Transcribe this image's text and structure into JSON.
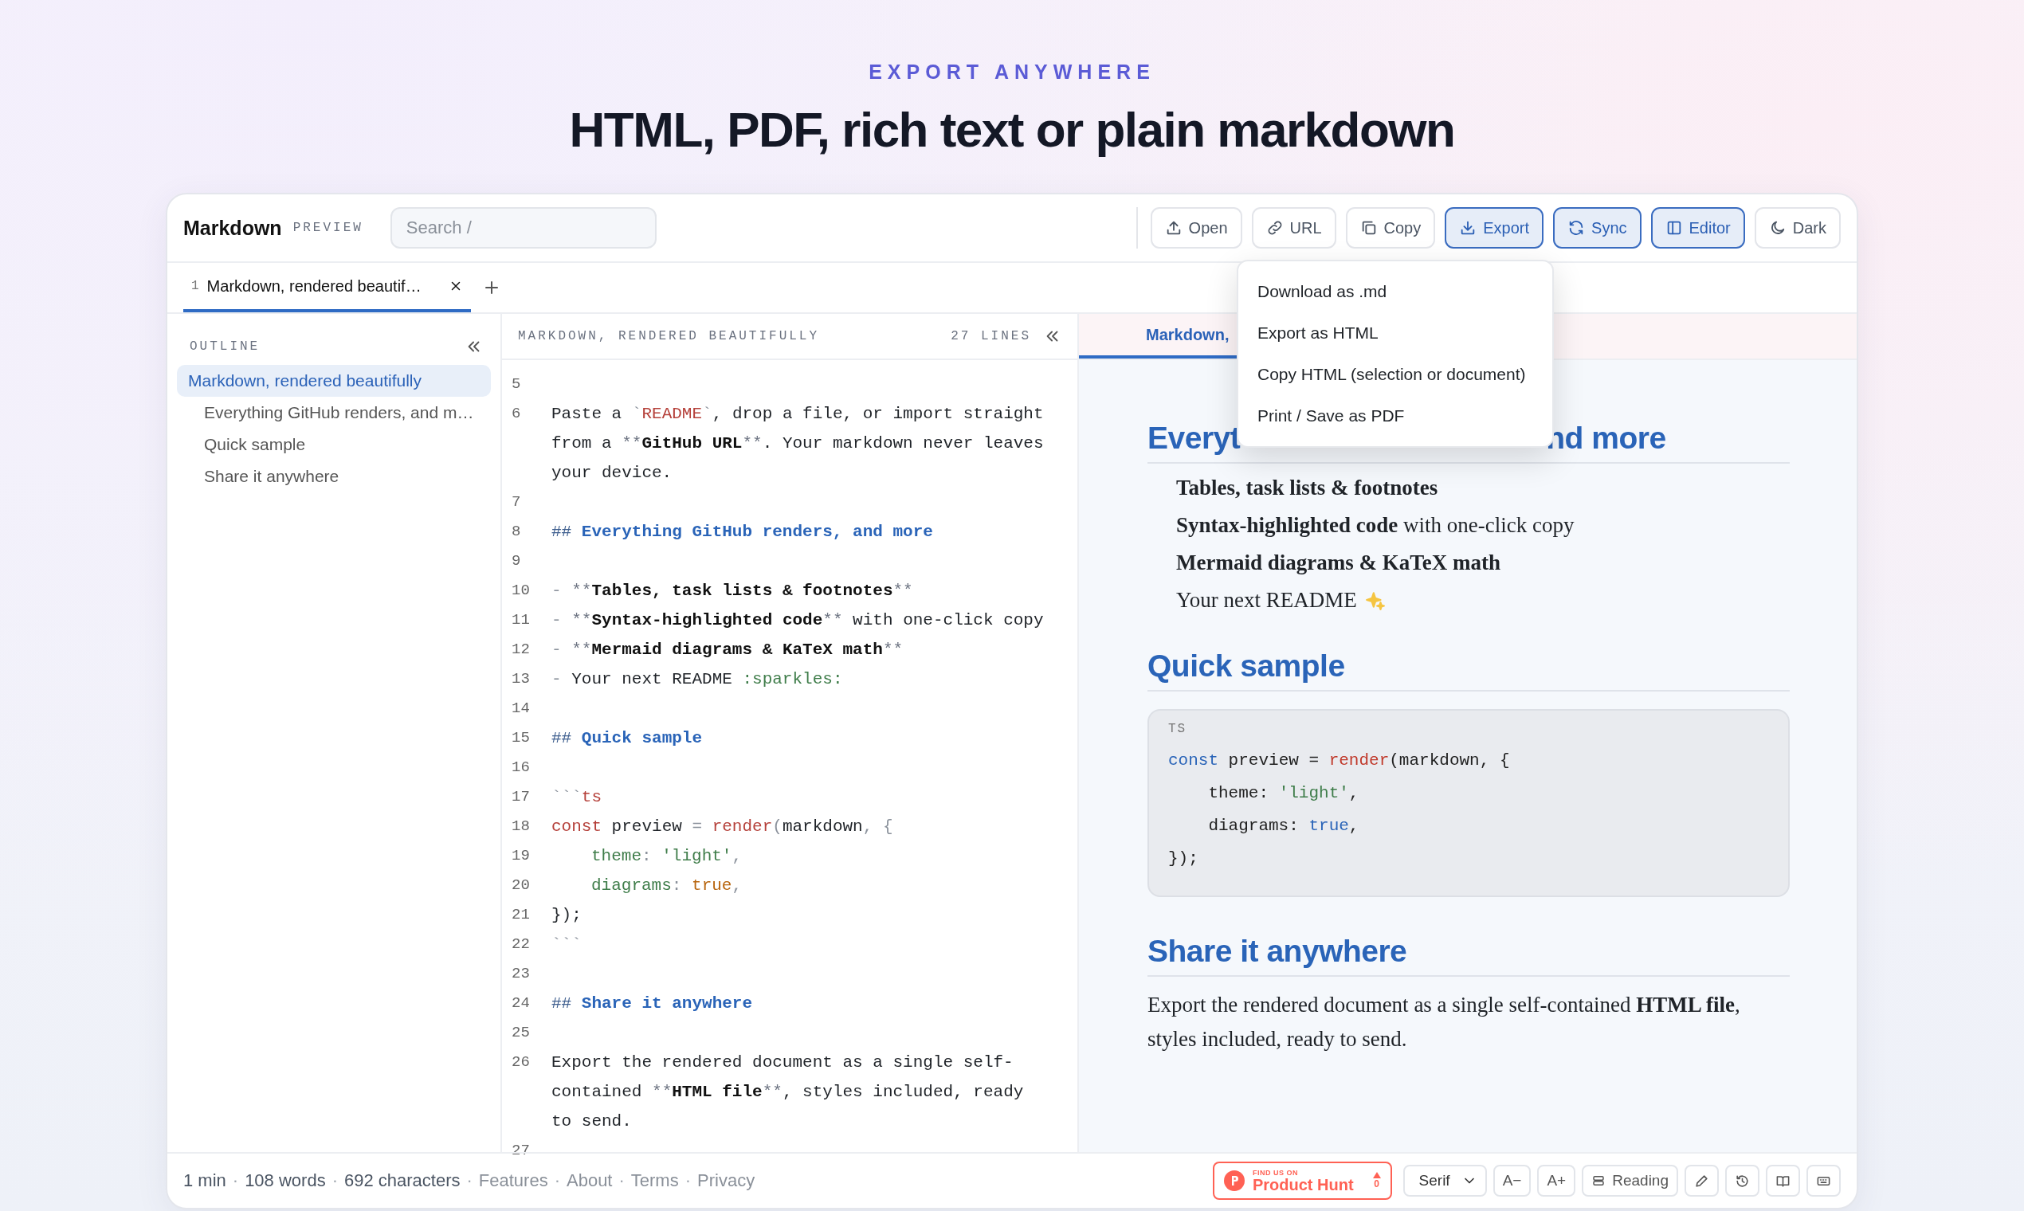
{
  "hero": {
    "eyebrow": "EXPORT ANYWHERE",
    "title": "HTML, PDF, rich text or plain markdown"
  },
  "app": {
    "brand": "Markdown",
    "brand_tag": "PREVIEW",
    "search": {
      "placeholder": "Search /"
    }
  },
  "toolbar": [
    {
      "label": "Open",
      "active": false
    },
    {
      "label": "URL",
      "active": false
    },
    {
      "label": "Copy",
      "active": false
    },
    {
      "label": "Export",
      "active": true
    },
    {
      "label": "Sync",
      "active": true
    },
    {
      "label": "Editor",
      "active": true
    },
    {
      "label": "Dark",
      "active": false
    }
  ],
  "export_menu": {
    "items": [
      "Download as .md",
      "Export as HTML",
      "Copy HTML (selection or document)",
      "Print / Save as PDF"
    ]
  },
  "tabs": [
    {
      "number": "1",
      "label": "Markdown, rendered beautif…",
      "selected": true
    }
  ],
  "outline": {
    "title": "OUTLINE",
    "items": [
      {
        "label": "Markdown, rendered beautifully",
        "selected": true,
        "children": [
          {
            "label": "Everything GitHub renders, and m…",
            "selected": false
          },
          {
            "label": "Quick sample",
            "selected": false
          },
          {
            "label": "Share it anywhere",
            "selected": false
          }
        ]
      }
    ]
  },
  "editor": {
    "title": "MARKDOWN, RENDERED BEAUTIFULLY",
    "line_count": "27 LINES",
    "lines": [
      {
        "number": "5"
      },
      {
        "number": "6",
        "segments": [
          {
            "kind": "text",
            "text": "Paste a "
          },
          {
            "kind": "punct",
            "text": "`"
          },
          {
            "kind": "code",
            "text": "README"
          },
          {
            "kind": "punct",
            "text": "`"
          },
          {
            "kind": "text",
            "text": ", drop a file, or import straight from a "
          },
          {
            "kind": "marker",
            "text": "**"
          },
          {
            "kind": "bold",
            "text": "GitHub URL"
          },
          {
            "kind": "marker",
            "text": "**"
          },
          {
            "kind": "text",
            "text": ". Your markdown never leaves your device."
          }
        ]
      },
      {
        "number": "7"
      },
      {
        "number": "8",
        "segments": [
          {
            "kind": "hmark",
            "text": "## "
          },
          {
            "kind": "heading",
            "text": "Everything GitHub renders, and more"
          }
        ]
      },
      {
        "number": "9"
      },
      {
        "number": "10",
        "segments": [
          {
            "kind": "punct",
            "text": "- "
          },
          {
            "kind": "marker",
            "text": "**"
          },
          {
            "kind": "bold",
            "text": "Tables, task lists & footnotes"
          },
          {
            "kind": "marker",
            "text": "**"
          }
        ]
      },
      {
        "number": "11",
        "segments": [
          {
            "kind": "punct",
            "text": "- "
          },
          {
            "kind": "marker",
            "text": "**"
          },
          {
            "kind": "bold",
            "text": "Syntax-highlighted code"
          },
          {
            "kind": "marker",
            "text": "**"
          },
          {
            "kind": "text",
            "text": " with one-click copy"
          }
        ]
      },
      {
        "number": "12",
        "segments": [
          {
            "kind": "punct",
            "text": "- "
          },
          {
            "kind": "marker",
            "text": "**"
          },
          {
            "kind": "bold",
            "text": "Mermaid diagrams & KaTeX math"
          },
          {
            "kind": "marker",
            "text": "**"
          }
        ]
      },
      {
        "number": "13",
        "segments": [
          {
            "kind": "punct",
            "text": "- "
          },
          {
            "kind": "text",
            "text": "Your next README"
          },
          {
            "kind": "prop",
            "text": " :sparkles:"
          }
        ]
      },
      {
        "number": "14"
      },
      {
        "number": "15",
        "segments": [
          {
            "kind": "hmark",
            "text": "## "
          },
          {
            "kind": "heading",
            "text": "Quick sample"
          }
        ]
      },
      {
        "number": "16"
      },
      {
        "number": "17",
        "segments": [
          {
            "kind": "punct",
            "text": "```"
          },
          {
            "kind": "code",
            "text": "ts"
          }
        ]
      },
      {
        "number": "18",
        "segments": [
          {
            "kind": "keyword",
            "text": "const"
          },
          {
            "kind": "text",
            "text": " preview"
          },
          {
            "kind": "punct",
            "text": " = "
          },
          {
            "kind": "func",
            "text": "render"
          },
          {
            "kind": "punct",
            "text": "("
          },
          {
            "kind": "text",
            "text": "markdown"
          },
          {
            "kind": "punct",
            "text": ", {"
          }
        ]
      },
      {
        "number": "19",
        "indented": true,
        "segments": [
          {
            "kind": "prop",
            "text": "theme"
          },
          {
            "kind": "punct",
            "text": ": "
          },
          {
            "kind": "str",
            "text": "'light'"
          },
          {
            "kind": "punct",
            "text": ","
          }
        ]
      },
      {
        "number": "20",
        "indented": true,
        "segments": [
          {
            "kind": "prop",
            "text": "diagrams"
          },
          {
            "kind": "punct",
            "text": ": "
          },
          {
            "kind": "bool",
            "text": "true"
          },
          {
            "kind": "punct",
            "text": ","
          }
        ]
      },
      {
        "number": "21",
        "segments": [
          {
            "kind": "text",
            "text": "});"
          }
        ]
      },
      {
        "number": "22",
        "segments": [
          {
            "kind": "punct",
            "text": "```"
          }
        ]
      },
      {
        "number": "23"
      },
      {
        "number": "24",
        "segments": [
          {
            "kind": "hmark",
            "text": "## "
          },
          {
            "kind": "heading",
            "text": "Share it anywhere"
          }
        ]
      },
      {
        "number": "25"
      },
      {
        "number": "26",
        "segments": [
          {
            "kind": "text",
            "text": "Export the rendered document as a single self-contained "
          },
          {
            "kind": "marker",
            "text": "**"
          },
          {
            "kind": "bold",
            "text": "HTML file"
          },
          {
            "kind": "marker",
            "text": "**"
          },
          {
            "kind": "text",
            "text": ", styles included, ready to send."
          }
        ]
      },
      {
        "number": "27"
      }
    ]
  },
  "preview": {
    "tabs": [
      {
        "label": "Markdown,",
        "selected": true
      }
    ],
    "blocks": [
      {
        "kind": "heading",
        "parts": [
          "Everyt",
          "nd more"
        ]
      },
      {
        "kind": "list",
        "items": [
          {
            "text": "**Tables, task lists & footnotes**"
          },
          {
            "text": "**Syntax-highlighted code** with one-click copy"
          },
          {
            "text": "**Mermaid diagrams & KaTeX math**"
          },
          {
            "text": "Your next README",
            "sparkle_icon": true
          }
        ]
      },
      {
        "kind": "heading",
        "parts": [
          "Quick sample"
        ]
      },
      {
        "kind": "code",
        "lang": "TS",
        "lines": [
          [
            {
              "kind": "keyword",
              "text": "const"
            },
            {
              "kind": "text",
              "text": " preview = "
            },
            {
              "kind": "func",
              "text": "render"
            },
            {
              "kind": "text",
              "text": "(markdown, {"
            }
          ],
          [
            {
              "kind": "text",
              "text": "    theme: "
            },
            {
              "kind": "str",
              "text": "'light'"
            },
            {
              "kind": "text",
              "text": ","
            }
          ],
          [
            {
              "kind": "text",
              "text": "    diagrams: "
            },
            {
              "kind": "bool",
              "text": "true"
            },
            {
              "kind": "text",
              "text": ","
            }
          ],
          [
            {
              "kind": "text",
              "text": "});"
            }
          ]
        ]
      },
      {
        "kind": "heading",
        "parts": [
          "Share it anywhere"
        ]
      },
      {
        "kind": "paragraph",
        "text": "Export the rendered document as a single self-contained **HTML file**, styles included, ready to send."
      }
    ]
  },
  "status_bar": {
    "separator": "·",
    "stats": [
      "1 min",
      "108 words",
      "692 characters"
    ],
    "links": [
      "Features",
      "About",
      "Terms",
      "Privacy"
    ],
    "product_hunt": {
      "eyebrow": "FIND US ON",
      "name": "Product Hunt",
      "votes": "0"
    },
    "font_select": "Serif",
    "size_buttons": [
      "A−",
      "A+"
    ],
    "reading": "Reading"
  }
}
